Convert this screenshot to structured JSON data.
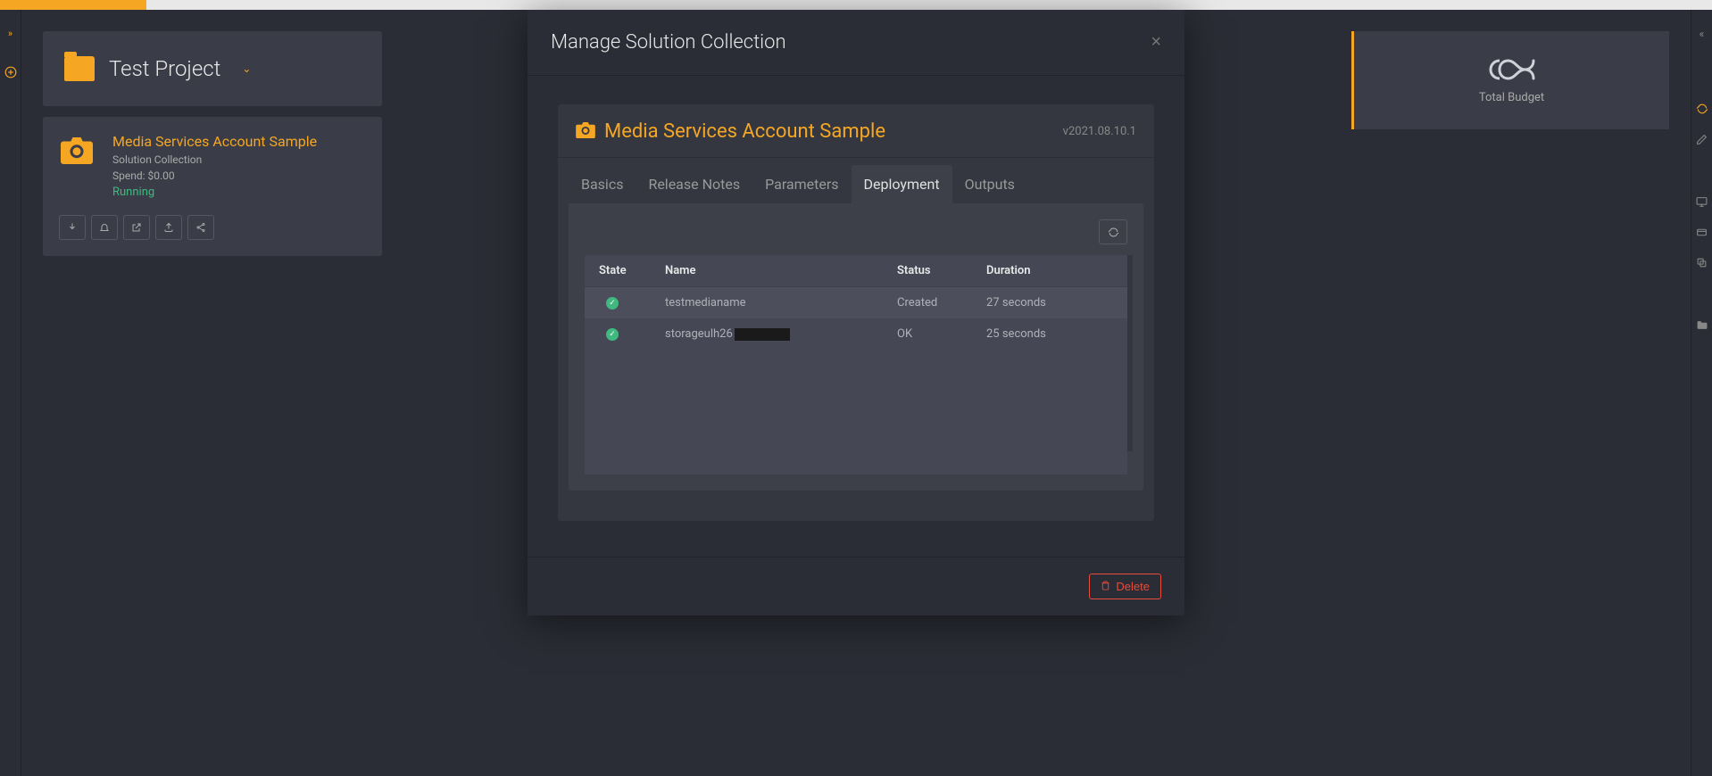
{
  "project": {
    "title": "Test Project"
  },
  "solution_card": {
    "name": "Media Services Account Sample",
    "type_label": "Solution Collection",
    "spend_label": "Spend: $0.00",
    "status": "Running"
  },
  "budget": {
    "label": "Total Budget"
  },
  "modal": {
    "title": "Manage Solution Collection",
    "panel_title": "Media Services Account Sample",
    "version": "v2021.08.10.1",
    "tabs": {
      "basics": "Basics",
      "release_notes": "Release Notes",
      "parameters": "Parameters",
      "deployment": "Deployment",
      "outputs": "Outputs"
    },
    "table": {
      "headers": {
        "state": "State",
        "name": "Name",
        "status": "Status",
        "duration": "Duration"
      },
      "rows": [
        {
          "name": "testmedianame",
          "status": "Created",
          "duration": "27 seconds",
          "redacted": false
        },
        {
          "name": "storageulh26",
          "status": "OK",
          "duration": "25 seconds",
          "redacted": true
        }
      ]
    },
    "delete_label": "Delete"
  }
}
